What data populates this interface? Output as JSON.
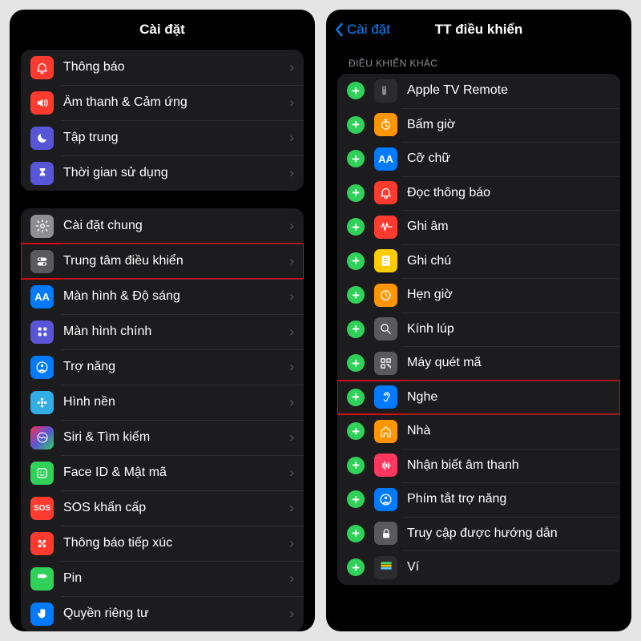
{
  "left": {
    "title": "Cài đặt",
    "group1": [
      {
        "key": "notifications",
        "label": "Thông báo",
        "color": "c-red",
        "glyph": "bell"
      },
      {
        "key": "sounds",
        "label": "Âm thanh & Cảm ứng",
        "color": "c-red",
        "glyph": "speaker"
      },
      {
        "key": "focus",
        "label": "Tập trung",
        "color": "c-indigo",
        "glyph": "moon"
      },
      {
        "key": "screentime",
        "label": "Thời gian sử dụng",
        "color": "c-indigo",
        "glyph": "hourglass"
      }
    ],
    "group2": [
      {
        "key": "general",
        "label": "Cài đặt chung",
        "color": "c-gray",
        "glyph": "gear"
      },
      {
        "key": "control-center",
        "label": "Trung tâm điều khiển",
        "color": "c-graydark",
        "glyph": "toggles",
        "highlight": true
      },
      {
        "key": "display",
        "label": "Màn hình & Độ sáng",
        "color": "c-blue",
        "glyph": "AA"
      },
      {
        "key": "home-screen",
        "label": "Màn hình chính",
        "color": "c-indigo",
        "glyph": "grid"
      },
      {
        "key": "accessibility",
        "label": "Trợ năng",
        "color": "c-blue",
        "glyph": "person"
      },
      {
        "key": "wallpaper",
        "label": "Hình nền",
        "color": "c-cyan",
        "glyph": "flower"
      },
      {
        "key": "siri",
        "label": "Siri & Tìm kiếm",
        "color": "c-gradient",
        "glyph": "siri"
      },
      {
        "key": "faceid",
        "label": "Face ID & Mật mã",
        "color": "c-green",
        "glyph": "face"
      },
      {
        "key": "sos",
        "label": "SOS khẩn cấp",
        "color": "c-red",
        "glyph": "SOS"
      },
      {
        "key": "exposure",
        "label": "Thông báo tiếp xúc",
        "color": "c-red",
        "glyph": "dots"
      },
      {
        "key": "battery",
        "label": "Pin",
        "color": "c-green",
        "glyph": "battery"
      },
      {
        "key": "privacy",
        "label": "Quyền riêng tư",
        "color": "c-blue",
        "glyph": "hand"
      }
    ]
  },
  "right": {
    "back_label": "Cài đặt",
    "title": "TT điều khiển",
    "section_header": "ĐIỀU KHIỂN KHÁC",
    "items": [
      {
        "key": "apple-tv-remote",
        "label": "Apple TV Remote",
        "color": "c-black",
        "glyph": "remote"
      },
      {
        "key": "stopwatch",
        "label": "Bấm giờ",
        "color": "c-orange",
        "glyph": "stopwatch"
      },
      {
        "key": "text-size",
        "label": "Cỡ chữ",
        "color": "c-blue",
        "glyph": "AA"
      },
      {
        "key": "read-notif",
        "label": "Đọc thông báo",
        "color": "c-red",
        "glyph": "bell"
      },
      {
        "key": "voice-memo",
        "label": "Ghi âm",
        "color": "c-red",
        "glyph": "wave"
      },
      {
        "key": "notes",
        "label": "Ghi chú",
        "color": "c-yellow",
        "glyph": "note"
      },
      {
        "key": "alarm",
        "label": "Hẹn giờ",
        "color": "c-orange",
        "glyph": "clock"
      },
      {
        "key": "magnifier",
        "label": "Kính lúp",
        "color": "c-graydark",
        "glyph": "search"
      },
      {
        "key": "code-scan",
        "label": "Máy quét mã",
        "color": "c-graydark",
        "glyph": "qr"
      },
      {
        "key": "hearing",
        "label": "Nghe",
        "color": "c-blue",
        "glyph": "ear",
        "highlight": true
      },
      {
        "key": "home",
        "label": "Nhà",
        "color": "c-orange",
        "glyph": "home"
      },
      {
        "key": "sound-recog",
        "label": "Nhận biết âm thanh",
        "color": "c-pink",
        "glyph": "waveform"
      },
      {
        "key": "shortcuts",
        "label": "Phím tắt trợ năng",
        "color": "c-blue",
        "glyph": "person"
      },
      {
        "key": "guided",
        "label": "Truy cập được hướng dẫn",
        "color": "c-graydark",
        "glyph": "lock"
      },
      {
        "key": "wallet",
        "label": "Ví",
        "color": "c-black",
        "glyph": "wallet"
      }
    ]
  }
}
